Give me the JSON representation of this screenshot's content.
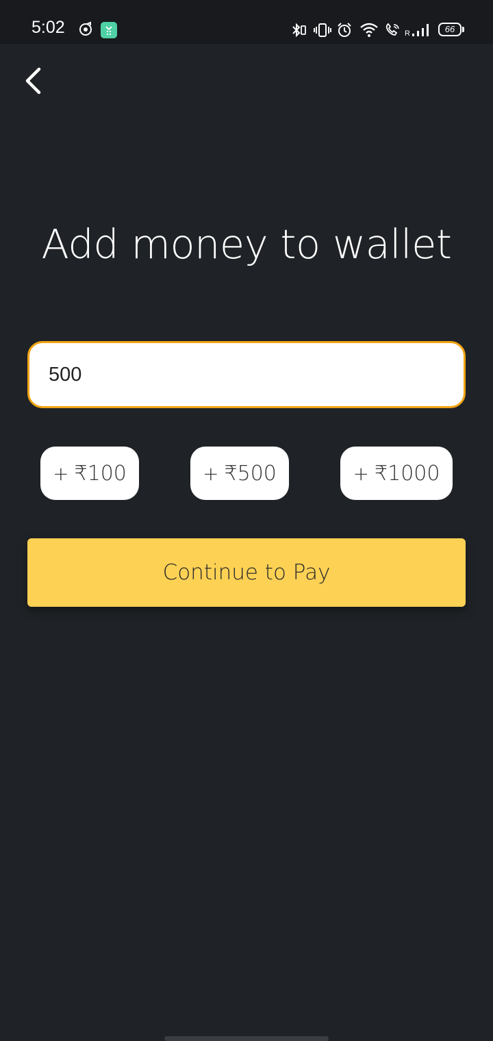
{
  "status_bar": {
    "time": "5:02",
    "battery": "66",
    "roaming": "R",
    "icons": [
      "music-app-icon",
      "shopping-app-icon",
      "bluetooth-icon",
      "vibrate-icon",
      "alarm-icon",
      "wifi-icon",
      "wifi-calling-icon",
      "signal-icon",
      "battery-icon"
    ]
  },
  "header": {
    "back_icon": "chevron-left-icon"
  },
  "page": {
    "title": "Add money to wallet"
  },
  "amount": {
    "value": "500",
    "border_color": "#f2a413"
  },
  "quick_add": [
    {
      "plus": "+",
      "label": "₹100"
    },
    {
      "plus": "+",
      "label": "₹500"
    },
    {
      "plus": "+",
      "label": "₹1000"
    }
  ],
  "continue": {
    "label": "Continue to Pay",
    "color": "#fdd154"
  },
  "colors": {
    "background": "#1f2226",
    "status_bar": "#181a1e"
  }
}
